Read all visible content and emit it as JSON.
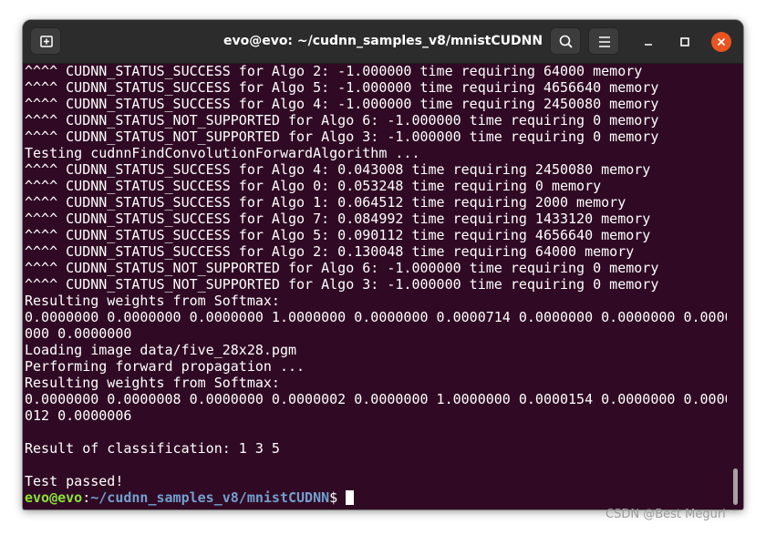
{
  "window": {
    "title": "evo@evo: ~/cudnn_samples_v8/mnistCUDNN"
  },
  "header": {
    "icons": {
      "new_tab": "new-tab-icon",
      "search": "search-icon",
      "menu": "hamburger-menu-icon",
      "minimize": "minimize-icon",
      "maximize": "maximize-icon",
      "close": "close-icon"
    },
    "colors": {
      "close_button": "#e95420",
      "titlebar": "#2c2c2c"
    }
  },
  "terminal": {
    "background": "#300a24",
    "lines": [
      "^^^^ CUDNN_STATUS_SUCCESS for Algo 2: -1.000000 time requiring 64000 memory",
      "^^^^ CUDNN_STATUS_SUCCESS for Algo 5: -1.000000 time requiring 4656640 memory",
      "^^^^ CUDNN_STATUS_SUCCESS for Algo 4: -1.000000 time requiring 2450080 memory",
      "^^^^ CUDNN_STATUS_NOT_SUPPORTED for Algo 6: -1.000000 time requiring 0 memory",
      "^^^^ CUDNN_STATUS_NOT_SUPPORTED for Algo 3: -1.000000 time requiring 0 memory",
      "Testing cudnnFindConvolutionForwardAlgorithm ...",
      "^^^^ CUDNN_STATUS_SUCCESS for Algo 4: 0.043008 time requiring 2450080 memory",
      "^^^^ CUDNN_STATUS_SUCCESS for Algo 0: 0.053248 time requiring 0 memory",
      "^^^^ CUDNN_STATUS_SUCCESS for Algo 1: 0.064512 time requiring 2000 memory",
      "^^^^ CUDNN_STATUS_SUCCESS for Algo 7: 0.084992 time requiring 1433120 memory",
      "^^^^ CUDNN_STATUS_SUCCESS for Algo 5: 0.090112 time requiring 4656640 memory",
      "^^^^ CUDNN_STATUS_SUCCESS for Algo 2: 0.130048 time requiring 64000 memory",
      "^^^^ CUDNN_STATUS_NOT_SUPPORTED for Algo 6: -1.000000 time requiring 0 memory",
      "^^^^ CUDNN_STATUS_NOT_SUPPORTED for Algo 3: -1.000000 time requiring 0 memory",
      "Resulting weights from Softmax:",
      "0.0000000 0.0000000 0.0000000 1.0000000 0.0000000 0.0000714 0.0000000 0.0000000 0.0000",
      "000 0.0000000",
      "Loading image data/five_28x28.pgm",
      "Performing forward propagation ...",
      "Resulting weights from Softmax:",
      "0.0000000 0.0000008 0.0000000 0.0000002 0.0000000 1.0000000 0.0000154 0.0000000 0.0000",
      "012 0.0000006",
      "",
      "Result of classification: 1 3 5",
      "",
      "Test passed!"
    ],
    "prompt": {
      "user_host": "evo@evo",
      "separator": ":",
      "path": "~/cudnn_samples_v8/mnistCUDNN",
      "symbol": "$ "
    },
    "prompt_colors": {
      "user_host": "#8ae234",
      "path": "#729fcf"
    }
  },
  "watermark": "CSDN @Best Meguri"
}
